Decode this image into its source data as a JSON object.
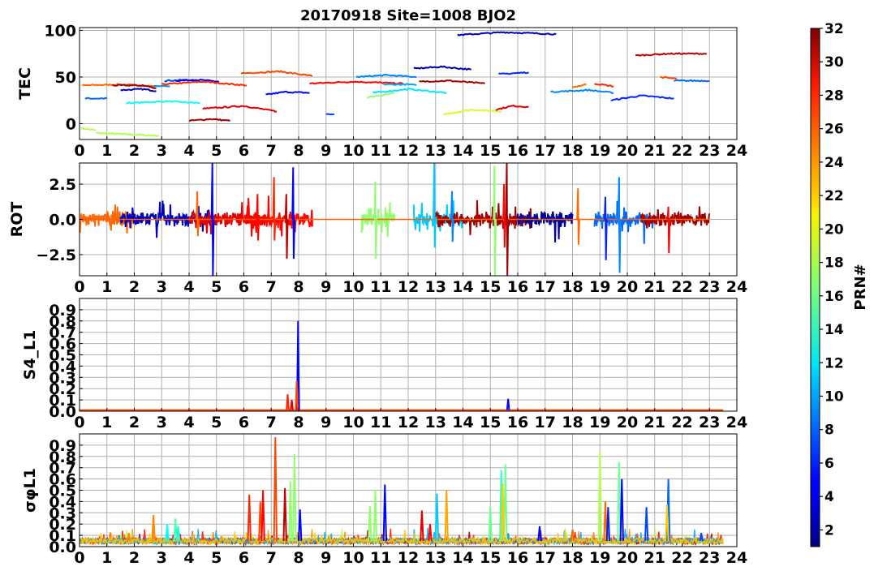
{
  "figure": {
    "title": "20170918 Site=1008 BJO2"
  },
  "colorbar": {
    "label": "PRN#",
    "min": 1,
    "max": 32,
    "ticks": [
      "2",
      "4",
      "6",
      "8",
      "10",
      "12",
      "14",
      "16",
      "18",
      "20",
      "22",
      "24",
      "26",
      "28",
      "30",
      "32"
    ]
  },
  "chart_data": [
    {
      "type": "line",
      "panel": "tec",
      "ylabel": "TEC",
      "xlim": [
        0,
        24
      ],
      "ylim": [
        -17,
        103
      ],
      "yticks": [
        "0",
        "50",
        "100"
      ],
      "xticks": [
        "0",
        "1",
        "2",
        "3",
        "4",
        "5",
        "6",
        "7",
        "8",
        "9",
        "10",
        "11",
        "12",
        "13",
        "14",
        "15",
        "16",
        "17",
        "18",
        "19",
        "20",
        "21",
        "22",
        "23",
        "24"
      ],
      "grid": true,
      "arcs": [
        {
          "prn": 18,
          "x": [
            0.05,
            0.6
          ],
          "y": [
            -5,
            -7
          ]
        },
        {
          "prn": 18,
          "x": [
            0.6,
            2.9
          ],
          "y": [
            -10,
            -13
          ]
        },
        {
          "prn": 8,
          "x": [
            0.2,
            1.0
          ],
          "y": [
            27,
            27
          ]
        },
        {
          "prn": 25,
          "x": [
            0.1,
            1.5,
            2.8
          ],
          "y": [
            41,
            42,
            40
          ]
        },
        {
          "prn": 13,
          "x": [
            1.7,
            3.2,
            4.4
          ],
          "y": [
            22,
            24,
            22
          ]
        },
        {
          "prn": 31,
          "x": [
            1.2,
            2.3,
            2.8
          ],
          "y": [
            41,
            41,
            38
          ]
        },
        {
          "prn": 3,
          "x": [
            1.5,
            2.3,
            2.8
          ],
          "y": [
            36,
            37,
            35
          ]
        },
        {
          "prn": 7,
          "x": [
            3.1,
            4.0,
            4.5
          ],
          "y": [
            46,
            47,
            45
          ]
        },
        {
          "prn": 5,
          "x": [
            3.5,
            4.3,
            5.1
          ],
          "y": [
            46,
            47,
            45
          ]
        },
        {
          "prn": 9,
          "x": [
            2.7,
            3.3
          ],
          "y": [
            40,
            40
          ]
        },
        {
          "prn": 27,
          "x": [
            3.0,
            4.5,
            6.1
          ],
          "y": [
            42,
            45,
            41
          ]
        },
        {
          "prn": 31,
          "x": [
            4.0,
            4.8,
            5.5
          ],
          "y": [
            3,
            5,
            3
          ]
        },
        {
          "prn": 29,
          "x": [
            4.5,
            6.0,
            7.2
          ],
          "y": [
            16,
            19,
            13
          ]
        },
        {
          "prn": 26,
          "x": [
            5.9,
            7.3,
            8.5
          ],
          "y": [
            54,
            56,
            51
          ]
        },
        {
          "prn": 5,
          "x": [
            6.8,
            7.5,
            8.4
          ],
          "y": [
            31,
            34,
            33
          ]
        },
        {
          "prn": 7,
          "x": [
            9.0,
            9.3
          ],
          "y": [
            10,
            10
          ]
        },
        {
          "prn": 28,
          "x": [
            8.4,
            10.0,
            11.8
          ],
          "y": [
            43,
            45,
            43
          ]
        },
        {
          "prn": 9,
          "x": [
            10.1,
            11.2,
            12.3
          ],
          "y": [
            50,
            52,
            50
          ]
        },
        {
          "prn": 17,
          "x": [
            10.5,
            11.5
          ],
          "y": [
            28,
            33
          ]
        },
        {
          "prn": 12,
          "x": [
            10.7,
            12.0,
            13.4
          ],
          "y": [
            33,
            37,
            33
          ]
        },
        {
          "prn": 2,
          "x": [
            12.2,
            13.2,
            14.3
          ],
          "y": [
            59,
            61,
            58
          ]
        },
        {
          "prn": 31,
          "x": [
            12.4,
            13.5,
            14.8
          ],
          "y": [
            45,
            46,
            43
          ]
        },
        {
          "prn": 10,
          "x": [
            11.1,
            12.0,
            12.3
          ],
          "y": [
            42,
            42,
            41
          ]
        },
        {
          "prn": 19,
          "x": [
            13.3,
            14.3,
            15.4
          ],
          "y": [
            10,
            15,
            13
          ]
        },
        {
          "prn": 29,
          "x": [
            15.2,
            15.8,
            16.4
          ],
          "y": [
            15,
            19,
            18
          ]
        },
        {
          "prn": 3,
          "x": [
            13.8,
            15.5,
            17.4
          ],
          "y": [
            95,
            98,
            96
          ]
        },
        {
          "prn": 6,
          "x": [
            15.3,
            16.4
          ],
          "y": [
            53,
            55
          ]
        },
        {
          "prn": 9,
          "x": [
            17.2,
            18.6,
            19.5
          ],
          "y": [
            34,
            36,
            33
          ]
        },
        {
          "prn": 25,
          "x": [
            18.0,
            18.5
          ],
          "y": [
            39,
            42
          ]
        },
        {
          "prn": 27,
          "x": [
            18.8,
            19.5
          ],
          "y": [
            43,
            40
          ]
        },
        {
          "prn": 6,
          "x": [
            19.4,
            20.5,
            21.7
          ],
          "y": [
            25,
            30,
            27
          ]
        },
        {
          "prn": 30,
          "x": [
            20.3,
            21.5,
            22.9
          ],
          "y": [
            73,
            75,
            75
          ]
        },
        {
          "prn": 26,
          "x": [
            21.2,
            21.8
          ],
          "y": [
            50,
            48
          ]
        },
        {
          "prn": 8,
          "x": [
            21.7,
            23.0
          ],
          "y": [
            46,
            46
          ]
        }
      ]
    },
    {
      "type": "line",
      "panel": "rot",
      "ylabel": "ROT",
      "xlim": [
        0,
        24
      ],
      "ylim": [
        -4,
        4
      ],
      "yticks": [
        "−2.5",
        "0.0",
        "2.5"
      ],
      "xticks": [
        "0",
        "1",
        "2",
        "3",
        "4",
        "5",
        "6",
        "7",
        "8",
        "9",
        "10",
        "11",
        "12",
        "13",
        "14",
        "15",
        "16",
        "17",
        "18",
        "19",
        "20",
        "21",
        "22",
        "23",
        "24"
      ],
      "grid": true,
      "spikes": [
        {
          "prn": 5,
          "x": 4.85,
          "y": [
            -4.0,
            4.0
          ]
        },
        {
          "prn": 25,
          "x": 4.3,
          "y": [
            -1.2,
            2.0
          ]
        },
        {
          "prn": 28,
          "x": 6.5,
          "y": [
            -1.5,
            1.8
          ]
        },
        {
          "prn": 27,
          "x": 7.1,
          "y": [
            -1.5,
            3.0
          ]
        },
        {
          "prn": 5,
          "x": 7.8,
          "y": [
            -2.8,
            3.7
          ]
        },
        {
          "prn": 30,
          "x": 7.55,
          "y": [
            -2.8,
            1.8
          ]
        },
        {
          "prn": 17,
          "x": 10.8,
          "y": [
            -2.8,
            2.7
          ]
        },
        {
          "prn": 11,
          "x": 12.95,
          "y": [
            -2.0,
            4.0
          ]
        },
        {
          "prn": 9,
          "x": 13.6,
          "y": [
            -1.6,
            2.0
          ]
        },
        {
          "prn": 17,
          "x": 15.15,
          "y": [
            -4.0,
            3.8
          ]
        },
        {
          "prn": 31,
          "x": 15.6,
          "y": [
            -4.0,
            4.0
          ]
        },
        {
          "prn": 28,
          "x": 15.5,
          "y": [
            -2.0,
            2.5
          ]
        },
        {
          "prn": 25,
          "x": 18.2,
          "y": [
            -1.8,
            2.2
          ]
        },
        {
          "prn": 6,
          "x": 19.2,
          "y": [
            -2.9,
            1.6
          ]
        },
        {
          "prn": 9,
          "x": 19.7,
          "y": [
            -3.8,
            3.0
          ]
        },
        {
          "prn": 28,
          "x": 21.5,
          "y": [
            -2.4,
            0.9
          ]
        }
      ],
      "active_periods": [
        {
          "prn": 25,
          "x": [
            0.0,
            2.0
          ]
        },
        {
          "prn": 3,
          "x": [
            1.5,
            5.0
          ]
        },
        {
          "prn": 29,
          "x": [
            4.0,
            7.0
          ]
        },
        {
          "prn": 28,
          "x": [
            6.0,
            8.5
          ]
        },
        {
          "prn": 17,
          "x": [
            10.3,
            11.5
          ]
        },
        {
          "prn": 11,
          "x": [
            12.2,
            14.0
          ]
        },
        {
          "prn": 31,
          "x": [
            13.0,
            16.5
          ]
        },
        {
          "prn": 2,
          "x": [
            16.0,
            18.0
          ]
        },
        {
          "prn": 8,
          "x": [
            18.8,
            21.0
          ]
        },
        {
          "prn": 31,
          "x": [
            20.5,
            23.0
          ]
        }
      ]
    },
    {
      "type": "line",
      "panel": "s4",
      "ylabel": "S4_L1",
      "xlim": [
        0,
        24
      ],
      "ylim": [
        0,
        1.0
      ],
      "yticks": [
        "0.0",
        "0.1",
        "0.2",
        "0.3",
        "0.4",
        "0.5",
        "0.6",
        "0.7",
        "0.8",
        "0.9"
      ],
      "xticks": [
        "0",
        "1",
        "2",
        "3",
        "4",
        "5",
        "6",
        "7",
        "8",
        "9",
        "10",
        "11",
        "12",
        "13",
        "14",
        "15",
        "16",
        "17",
        "18",
        "19",
        "20",
        "21",
        "22",
        "23",
        "24"
      ],
      "grid": true,
      "spikes": [
        {
          "prn": 5,
          "x": 7.98,
          "y": 0.8
        },
        {
          "prn": 26,
          "x": 7.93,
          "y": 0.27
        },
        {
          "prn": 27,
          "x": 7.6,
          "y": 0.15
        },
        {
          "prn": 29,
          "x": 7.75,
          "y": 0.1
        },
        {
          "prn": 5,
          "x": 15.65,
          "y": 0.11
        }
      ],
      "baseline": 0.01
    },
    {
      "type": "line",
      "panel": "sigma_phi",
      "ylabel": "σφL1",
      "xlim": [
        0,
        24
      ],
      "ylim": [
        0,
        1.0
      ],
      "yticks": [
        "0.0",
        "0.1",
        "0.2",
        "0.3",
        "0.4",
        "0.5",
        "0.6",
        "0.7",
        "0.8",
        "0.9"
      ],
      "xticks": [
        "0",
        "1",
        "2",
        "3",
        "4",
        "5",
        "6",
        "7",
        "8",
        "9",
        "10",
        "11",
        "12",
        "13",
        "14",
        "15",
        "16",
        "17",
        "18",
        "19",
        "20",
        "21",
        "22",
        "23",
        "24"
      ],
      "grid": true,
      "spikes": [
        {
          "prn": 24,
          "x": 1.8,
          "y": 0.12
        },
        {
          "prn": 24,
          "x": 2.7,
          "y": 0.28
        },
        {
          "prn": 13,
          "x": 3.2,
          "y": 0.2
        },
        {
          "prn": 15,
          "x": 3.5,
          "y": 0.25
        },
        {
          "prn": 13,
          "x": 3.6,
          "y": 0.18
        },
        {
          "prn": 27,
          "x": 6.2,
          "y": 0.46
        },
        {
          "prn": 26,
          "x": 6.6,
          "y": 0.4
        },
        {
          "prn": 28,
          "x": 6.7,
          "y": 0.5
        },
        {
          "prn": 26,
          "x": 7.15,
          "y": 0.97
        },
        {
          "prn": 30,
          "x": 7.5,
          "y": 0.52
        },
        {
          "prn": 17,
          "x": 7.85,
          "y": 0.82
        },
        {
          "prn": 17,
          "x": 7.7,
          "y": 0.58
        },
        {
          "prn": 5,
          "x": 8.05,
          "y": 0.33
        },
        {
          "prn": 17,
          "x": 10.8,
          "y": 0.5
        },
        {
          "prn": 17,
          "x": 10.6,
          "y": 0.36
        },
        {
          "prn": 5,
          "x": 11.15,
          "y": 0.55
        },
        {
          "prn": 29,
          "x": 12.5,
          "y": 0.32
        },
        {
          "prn": 28,
          "x": 12.8,
          "y": 0.2
        },
        {
          "prn": 11,
          "x": 13.05,
          "y": 0.47
        },
        {
          "prn": 23,
          "x": 13.4,
          "y": 0.5
        },
        {
          "prn": 16,
          "x": 15.0,
          "y": 0.35
        },
        {
          "prn": 14,
          "x": 15.4,
          "y": 0.68
        },
        {
          "prn": 16,
          "x": 15.55,
          "y": 0.73
        },
        {
          "prn": 22,
          "x": 15.45,
          "y": 0.56
        },
        {
          "prn": 5,
          "x": 16.8,
          "y": 0.18
        },
        {
          "prn": 25,
          "x": 18.0,
          "y": 0.15
        },
        {
          "prn": 18,
          "x": 19.0,
          "y": 0.85
        },
        {
          "prn": 25,
          "x": 19.2,
          "y": 0.4
        },
        {
          "prn": 6,
          "x": 19.3,
          "y": 0.35
        },
        {
          "prn": 16,
          "x": 19.7,
          "y": 0.75
        },
        {
          "prn": 5,
          "x": 19.8,
          "y": 0.6
        },
        {
          "prn": 7,
          "x": 20.7,
          "y": 0.35
        },
        {
          "prn": 8,
          "x": 21.5,
          "y": 0.6
        },
        {
          "prn": 22,
          "x": 21.45,
          "y": 0.37
        },
        {
          "prn": 7,
          "x": 22.7,
          "y": 0.12
        }
      ],
      "baseline": 0.05
    }
  ]
}
